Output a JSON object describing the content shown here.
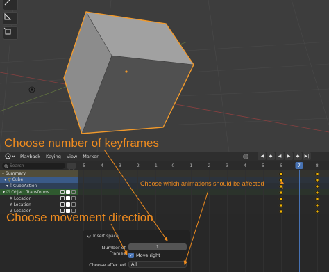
{
  "annotations": {
    "keyframes_count": "Choose number of keyframes",
    "affected_animations": "Choose which animations should be affected",
    "movement_direction": "Choose movement direction"
  },
  "dopesheet": {
    "menus": [
      "Playback",
      "Keying",
      "View",
      "Marker"
    ],
    "search_placeholder": "Search",
    "ruler_ticks": [
      "-5",
      "-4",
      "-3",
      "-2",
      "-1",
      "0",
      "1",
      "2",
      "3",
      "4",
      "5",
      "6",
      "7",
      "8"
    ],
    "current_frame": "7",
    "channels": [
      {
        "label": "Summary",
        "kind": "summary"
      },
      {
        "label": "Cube",
        "kind": "obj"
      },
      {
        "label": "CubeAction",
        "kind": "action"
      },
      {
        "label": "Object Transforms",
        "kind": "group"
      },
      {
        "label": "X Location",
        "kind": "fcurve"
      },
      {
        "label": "Y Location",
        "kind": "fcurve"
      },
      {
        "label": "Z Location",
        "kind": "fcurve"
      }
    ],
    "keyframe_frames": [
      6,
      8
    ],
    "playback_icons": [
      "jump-start-icon",
      "prev-key-icon",
      "play-reverse-icon",
      "play-icon",
      "next-key-icon",
      "jump-end-icon"
    ]
  },
  "redo_panel": {
    "title": "Insert space",
    "number_of_frames_label": "Number of Frames",
    "number_of_frames_value": "1",
    "move_right_label": "Move right",
    "move_right_checked": true,
    "choose_affected_label": "Choose affected",
    "choose_affected_value": "All"
  },
  "colors": {
    "accent_orange": "#f08c1f",
    "keyframe": "#f2b300",
    "selection_blue": "#4772b3"
  }
}
